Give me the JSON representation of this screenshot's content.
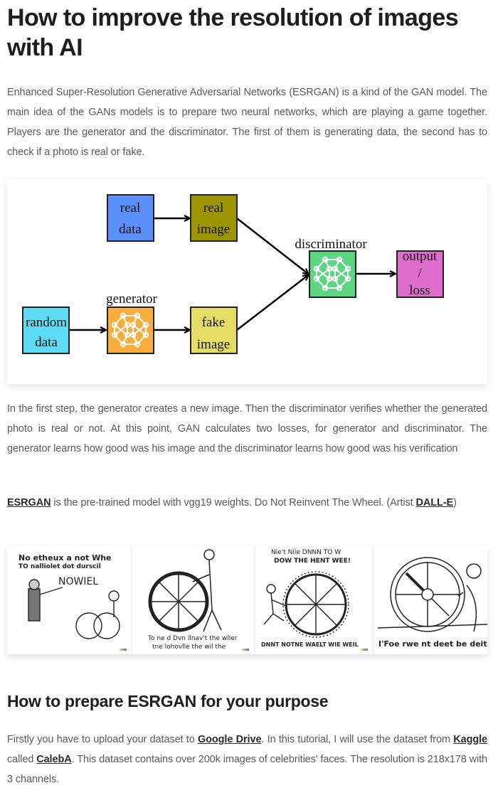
{
  "article": {
    "title": "How to improve the resolution of images with AI",
    "intro": "Enhanced Super-Resolution Generative Adversarial Networks (ESRGAN) is a kind of the GAN model. The main idea of the GANs models is to prepare two neural networks, which are playing a game together. Players are the generator and the discriminator. The first of them is generating data, the second has to check if a photo is real or fake.",
    "diagram": {
      "nodes": {
        "real_data": [
          "real",
          "data"
        ],
        "real_image": [
          "real",
          "image"
        ],
        "random_data": [
          "random",
          "data"
        ],
        "generator": "generator",
        "fake_image": [
          "fake",
          "image"
        ],
        "discriminator": "discriminator",
        "output": [
          "output",
          "/",
          "loss"
        ]
      },
      "colors": {
        "real_data": "#5b8ff9",
        "real_image": "#9c9400",
        "random_data": "#5fdcf5",
        "generator": "#f7ae3d",
        "fake_image": "#e6de64",
        "discriminator": "#5cd683",
        "output": "#e06ccc"
      }
    },
    "explanation": "In the first step, the generator creates a new image. Then the discriminator verifies whether the generated photo is real or not. At this point, GAN calculates two losses, for generator and discriminator. The generator learns how good was his image and the discriminator learns how good was his verification",
    "esrgan_para": {
      "link1": "ESRGAN",
      "text1": " is the pre-trained model with vgg19 weights. Do Not Reinvent The Wheel. (Artist ",
      "link2": "DALL-E",
      "text2": ")"
    },
    "gallery": {
      "captions": [
        [
          "No etheux a not Whe",
          "TO nalliolet dot durscil",
          "NOWIEL"
        ],
        [
          "To ne d Dvn ilnav't the wller",
          "tne lohovlle the wil the"
        ],
        [
          "Nie't Niie DNNN TO W",
          "DOW THE HENT WEE!",
          "DNNT NOTNE WAELT WIE WEIL"
        ],
        [
          "I'Foe rwe nt deet be deit d"
        ]
      ]
    },
    "section2_title": "How to prepare ESRGAN for your purpose",
    "prep_para": {
      "text1": "Firstly you have to upload your dataset to ",
      "link1": "Google Drive",
      "text2": ". In this tutorial, I will use the dataset from ",
      "link2": "Kaggle",
      "text3": " called ",
      "link3": "CalebA",
      "text4": ". This dataset contains over 200k images of celebrities' faces. The resolution is 218x178 with 3 channels."
    }
  }
}
